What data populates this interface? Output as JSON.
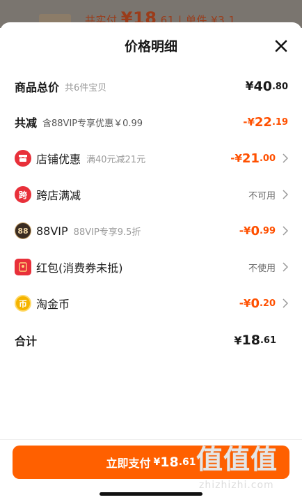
{
  "background": {
    "price_text_prefix": "共实付",
    "price_big": "¥18",
    "price_small": ".61",
    "unit_text": "| 单件 ¥3.1"
  },
  "sheet": {
    "title": "价格明细"
  },
  "rows": {
    "total": {
      "label": "商品总价",
      "sub": "共6件宝贝",
      "yen": "¥",
      "big": "40",
      "small": ".80"
    },
    "discount": {
      "label": "共减",
      "sub": "含88VIP专享优惠￥0.99",
      "prefix": "-¥",
      "big": "22",
      "small": ".19"
    },
    "store": {
      "label": "店铺优惠",
      "sub": "满40元减21元",
      "prefix": "-¥",
      "big": "21",
      "small": ".00"
    },
    "cross": {
      "label": "跨店满减",
      "icon_text": "跨",
      "value": "不可用"
    },
    "vip": {
      "label": "88VIP",
      "icon_text": "88",
      "sub": "88VIP专享9.5折",
      "prefix": "-¥",
      "big": "0",
      "small": ".99"
    },
    "redpacket": {
      "label": "红包(消费券未抵)",
      "value": "不使用"
    },
    "coin": {
      "label": "淘金币",
      "icon_text": "币",
      "prefix": "-¥",
      "big": "0",
      "small": ".20"
    },
    "sum": {
      "label": "合计",
      "yen": "¥",
      "big": "18",
      "small": ".61"
    }
  },
  "pay_button": {
    "label": "立即支付",
    "yen": "¥",
    "big": "18",
    "small": ".61"
  },
  "watermark": {
    "glyphs": "值值值",
    "url": "zhizhizhi.com"
  },
  "colors": {
    "accent": "#ff6000",
    "discount_text": "#ff5000",
    "store_icon": "#e8303a",
    "cross_icon": "#e8303a",
    "vip_icon": "#3a2c22",
    "red_icon": "#e8303a",
    "coin_icon": "#f5b400"
  },
  "icons": {
    "close": "close-icon",
    "store": "store-icon",
    "cross": "cross-store-icon",
    "vip": "88vip-icon",
    "redpacket": "red-packet-icon",
    "coin": "gold-coin-icon",
    "chevron": "chevron-right-icon"
  }
}
